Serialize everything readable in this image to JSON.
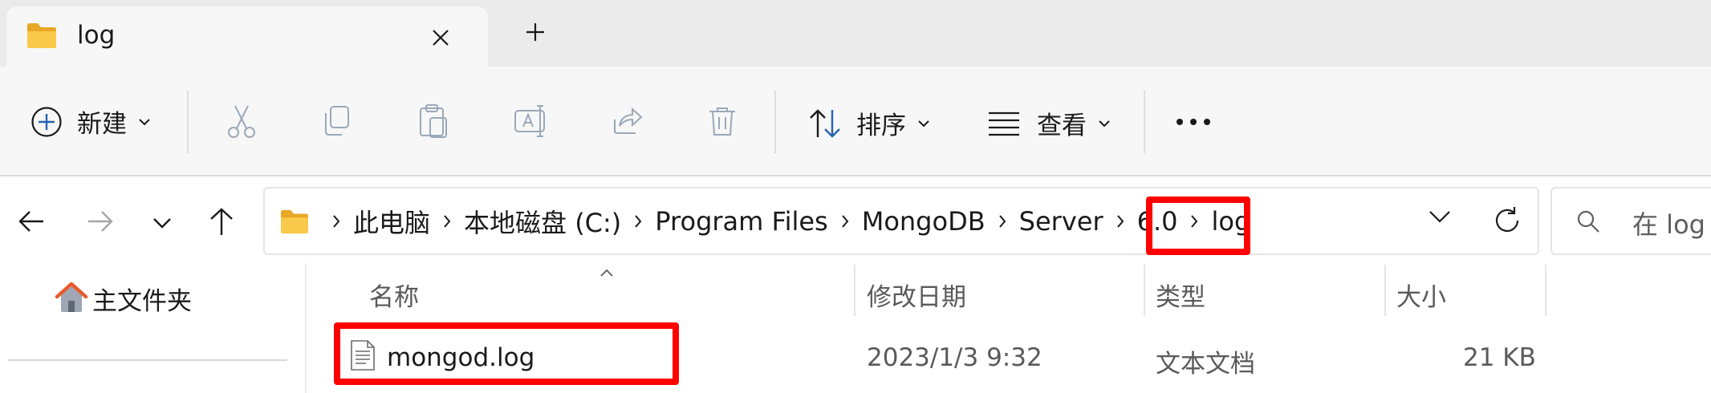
{
  "tab": {
    "title": "log",
    "close_icon": "close-icon",
    "new_tab_icon": "plus-icon"
  },
  "toolbar": {
    "new_label": "新建",
    "sort_label": "排序",
    "view_label": "查看",
    "disabled_actions": [
      "cut",
      "copy",
      "paste",
      "rename",
      "share",
      "delete"
    ]
  },
  "address": {
    "breadcrumbs": [
      "此电脑",
      "本地磁盘 (C:)",
      "Program Files",
      "MongoDB",
      "Server",
      "6.0",
      "log"
    ]
  },
  "search": {
    "placeholder": "在 log 中"
  },
  "sidebar": {
    "home_label": "主文件夹"
  },
  "columns": {
    "name": "名称",
    "modified": "修改日期",
    "type": "类型",
    "size": "大小"
  },
  "files": [
    {
      "name": "mongod.log",
      "modified": "2023/1/3 9:32",
      "type": "文本文档",
      "size": "21 KB"
    }
  ],
  "colors": {
    "highlight": "#ff0000",
    "folder": "#f6c141",
    "accent": "#2563b0"
  }
}
